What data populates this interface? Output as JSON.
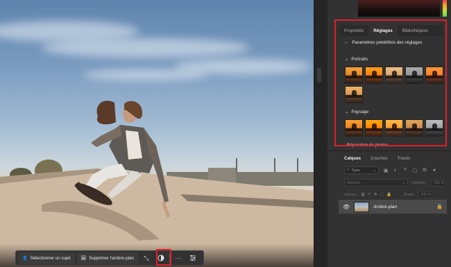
{
  "task_bar": {
    "select_subject": "Sélectionner un sujet",
    "remove_background": "Supprimer l'arrière-plan",
    "more": "···"
  },
  "adjustments_panel": {
    "tabs": [
      {
        "label": "Propriétés",
        "active": false
      },
      {
        "label": "Réglages",
        "active": true
      },
      {
        "label": "Bibliothèques",
        "active": false
      }
    ],
    "back_title": "Paramètres prédéfinis des réglages",
    "sections": [
      {
        "label": "Portraits",
        "thumb_count": 6
      },
      {
        "label": "Paysage",
        "thumb_count": 5
      }
    ],
    "next_section": "Réparation de photos"
  },
  "layers_panel": {
    "tabs": [
      {
        "label": "Calques",
        "active": true
      },
      {
        "label": "Couches",
        "active": false
      },
      {
        "label": "Tracés",
        "active": false
      }
    ],
    "kind_placeholder": "Type",
    "blend_mode": "Normal",
    "opacity_label": "Opacité :",
    "opacity_value": "100 %",
    "lock_label": "Verrou :",
    "fill_label": "Fond :",
    "fill_value": "100 %",
    "layer_name": "Arrière-plan"
  },
  "colors": {
    "highlight": "#e0202a",
    "panel_bg": "#323232",
    "selected_layer": "#4a4a4a"
  }
}
